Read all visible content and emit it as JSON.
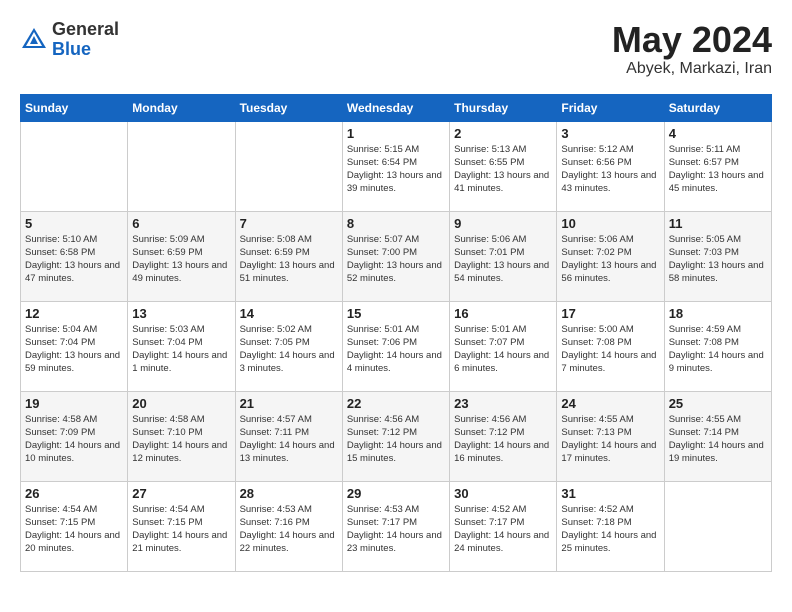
{
  "header": {
    "logo_general": "General",
    "logo_blue": "Blue",
    "title": "May 2024",
    "location": "Abyek, Markazi, Iran"
  },
  "days_of_week": [
    "Sunday",
    "Monday",
    "Tuesday",
    "Wednesday",
    "Thursday",
    "Friday",
    "Saturday"
  ],
  "weeks": [
    [
      {
        "day": "",
        "info": ""
      },
      {
        "day": "",
        "info": ""
      },
      {
        "day": "",
        "info": ""
      },
      {
        "day": "1",
        "info": "Sunrise: 5:15 AM\nSunset: 6:54 PM\nDaylight: 13 hours\nand 39 minutes."
      },
      {
        "day": "2",
        "info": "Sunrise: 5:13 AM\nSunset: 6:55 PM\nDaylight: 13 hours\nand 41 minutes."
      },
      {
        "day": "3",
        "info": "Sunrise: 5:12 AM\nSunset: 6:56 PM\nDaylight: 13 hours\nand 43 minutes."
      },
      {
        "day": "4",
        "info": "Sunrise: 5:11 AM\nSunset: 6:57 PM\nDaylight: 13 hours\nand 45 minutes."
      }
    ],
    [
      {
        "day": "5",
        "info": "Sunrise: 5:10 AM\nSunset: 6:58 PM\nDaylight: 13 hours\nand 47 minutes."
      },
      {
        "day": "6",
        "info": "Sunrise: 5:09 AM\nSunset: 6:59 PM\nDaylight: 13 hours\nand 49 minutes."
      },
      {
        "day": "7",
        "info": "Sunrise: 5:08 AM\nSunset: 6:59 PM\nDaylight: 13 hours\nand 51 minutes."
      },
      {
        "day": "8",
        "info": "Sunrise: 5:07 AM\nSunset: 7:00 PM\nDaylight: 13 hours\nand 52 minutes."
      },
      {
        "day": "9",
        "info": "Sunrise: 5:06 AM\nSunset: 7:01 PM\nDaylight: 13 hours\nand 54 minutes."
      },
      {
        "day": "10",
        "info": "Sunrise: 5:06 AM\nSunset: 7:02 PM\nDaylight: 13 hours\nand 56 minutes."
      },
      {
        "day": "11",
        "info": "Sunrise: 5:05 AM\nSunset: 7:03 PM\nDaylight: 13 hours\nand 58 minutes."
      }
    ],
    [
      {
        "day": "12",
        "info": "Sunrise: 5:04 AM\nSunset: 7:04 PM\nDaylight: 13 hours\nand 59 minutes."
      },
      {
        "day": "13",
        "info": "Sunrise: 5:03 AM\nSunset: 7:04 PM\nDaylight: 14 hours\nand 1 minute."
      },
      {
        "day": "14",
        "info": "Sunrise: 5:02 AM\nSunset: 7:05 PM\nDaylight: 14 hours\nand 3 minutes."
      },
      {
        "day": "15",
        "info": "Sunrise: 5:01 AM\nSunset: 7:06 PM\nDaylight: 14 hours\nand 4 minutes."
      },
      {
        "day": "16",
        "info": "Sunrise: 5:01 AM\nSunset: 7:07 PM\nDaylight: 14 hours\nand 6 minutes."
      },
      {
        "day": "17",
        "info": "Sunrise: 5:00 AM\nSunset: 7:08 PM\nDaylight: 14 hours\nand 7 minutes."
      },
      {
        "day": "18",
        "info": "Sunrise: 4:59 AM\nSunset: 7:08 PM\nDaylight: 14 hours\nand 9 minutes."
      }
    ],
    [
      {
        "day": "19",
        "info": "Sunrise: 4:58 AM\nSunset: 7:09 PM\nDaylight: 14 hours\nand 10 minutes."
      },
      {
        "day": "20",
        "info": "Sunrise: 4:58 AM\nSunset: 7:10 PM\nDaylight: 14 hours\nand 12 minutes."
      },
      {
        "day": "21",
        "info": "Sunrise: 4:57 AM\nSunset: 7:11 PM\nDaylight: 14 hours\nand 13 minutes."
      },
      {
        "day": "22",
        "info": "Sunrise: 4:56 AM\nSunset: 7:12 PM\nDaylight: 14 hours\nand 15 minutes."
      },
      {
        "day": "23",
        "info": "Sunrise: 4:56 AM\nSunset: 7:12 PM\nDaylight: 14 hours\nand 16 minutes."
      },
      {
        "day": "24",
        "info": "Sunrise: 4:55 AM\nSunset: 7:13 PM\nDaylight: 14 hours\nand 17 minutes."
      },
      {
        "day": "25",
        "info": "Sunrise: 4:55 AM\nSunset: 7:14 PM\nDaylight: 14 hours\nand 19 minutes."
      }
    ],
    [
      {
        "day": "26",
        "info": "Sunrise: 4:54 AM\nSunset: 7:15 PM\nDaylight: 14 hours\nand 20 minutes."
      },
      {
        "day": "27",
        "info": "Sunrise: 4:54 AM\nSunset: 7:15 PM\nDaylight: 14 hours\nand 21 minutes."
      },
      {
        "day": "28",
        "info": "Sunrise: 4:53 AM\nSunset: 7:16 PM\nDaylight: 14 hours\nand 22 minutes."
      },
      {
        "day": "29",
        "info": "Sunrise: 4:53 AM\nSunset: 7:17 PM\nDaylight: 14 hours\nand 23 minutes."
      },
      {
        "day": "30",
        "info": "Sunrise: 4:52 AM\nSunset: 7:17 PM\nDaylight: 14 hours\nand 24 minutes."
      },
      {
        "day": "31",
        "info": "Sunrise: 4:52 AM\nSunset: 7:18 PM\nDaylight: 14 hours\nand 25 minutes."
      },
      {
        "day": "",
        "info": ""
      }
    ]
  ]
}
